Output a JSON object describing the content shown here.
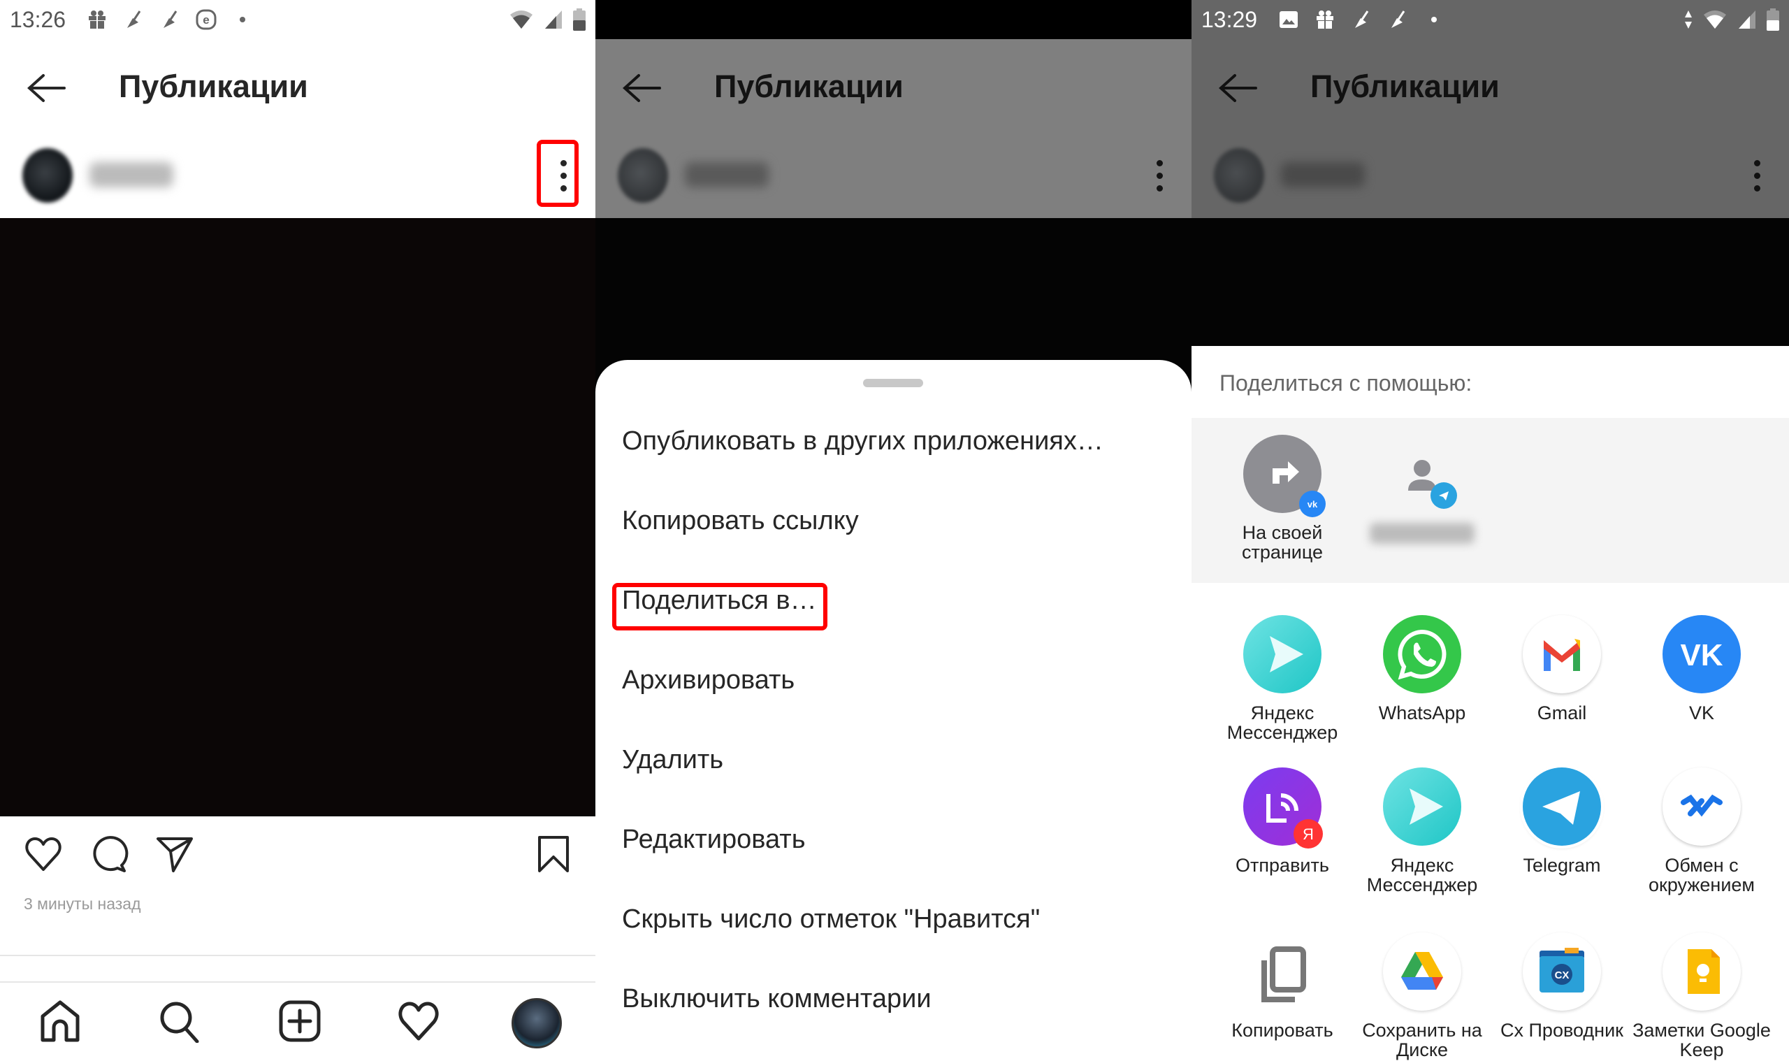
{
  "panel1": {
    "status": {
      "time": "13:26",
      "icons": [
        "gift-icon",
        "broom-icon",
        "broom-icon",
        "e-circle-icon",
        "dot-icon"
      ],
      "right_icons": [
        "wifi-icon",
        "signal-icon",
        "battery-icon"
      ]
    },
    "header": {
      "title": "Публикации",
      "back_icon": "arrow-left-icon"
    },
    "post": {
      "menu_icon": "more-vertical-icon",
      "highlighted": "more-vertical-icon"
    },
    "actions": {
      "like": "heart-icon",
      "comment": "comment-icon",
      "share": "send-icon",
      "save": "bookmark-icon"
    },
    "timestamp": "3 минуты назад",
    "nav": [
      "home-icon",
      "search-icon",
      "add-post-icon",
      "activity-heart-icon",
      "profile-avatar"
    ]
  },
  "panel2": {
    "header": {
      "title": "Публикации"
    },
    "menu": [
      {
        "label": "Опубликовать в других приложениях…"
      },
      {
        "label": "Копировать ссылку"
      },
      {
        "label": "Поделиться в…",
        "highlighted": true
      },
      {
        "label": "Архивировать"
      },
      {
        "label": "Удалить"
      },
      {
        "label": "Редактировать"
      },
      {
        "label": "Скрыть число отметок \"Нравится\""
      },
      {
        "label": "Выключить комментарии"
      }
    ]
  },
  "panel3": {
    "status": {
      "time": "13:29"
    },
    "header": {
      "title": "Публикации"
    },
    "share_title": "Поделиться с помощью:",
    "direct": [
      {
        "label": "На своей странице",
        "badge": "vk"
      },
      {
        "label": "",
        "badge": "telegram",
        "blurred": true
      }
    ],
    "apps": [
      {
        "label": "Яндекс Мессенджер",
        "icon": "yandex-messenger-icon"
      },
      {
        "label": "WhatsApp",
        "icon": "whatsapp-icon"
      },
      {
        "label": "Gmail",
        "icon": "gmail-icon"
      },
      {
        "label": "VK",
        "icon": "vk-icon"
      },
      {
        "label": "Отправить",
        "icon": "yandex-send-icon"
      },
      {
        "label": "Яндекс Мессенджер",
        "icon": "yandex-messenger-icon"
      },
      {
        "label": "Telegram",
        "icon": "telegram-icon"
      },
      {
        "label": "Обмен с окружением",
        "icon": "nearby-share-icon"
      },
      {
        "label": "Копировать",
        "icon": "copy-icon"
      },
      {
        "label": "Сохранить на Диске",
        "icon": "google-drive-icon"
      },
      {
        "label": "Cx Проводник",
        "icon": "cx-explorer-icon"
      },
      {
        "label": "Заметки Google Keep",
        "icon": "google-keep-icon"
      }
    ]
  },
  "colors": {
    "highlight": "#ff0000",
    "vk": "#2787f5",
    "whatsapp": "#25d366",
    "telegram": "#2aa3e0",
    "dim": "#7f7f7f"
  }
}
